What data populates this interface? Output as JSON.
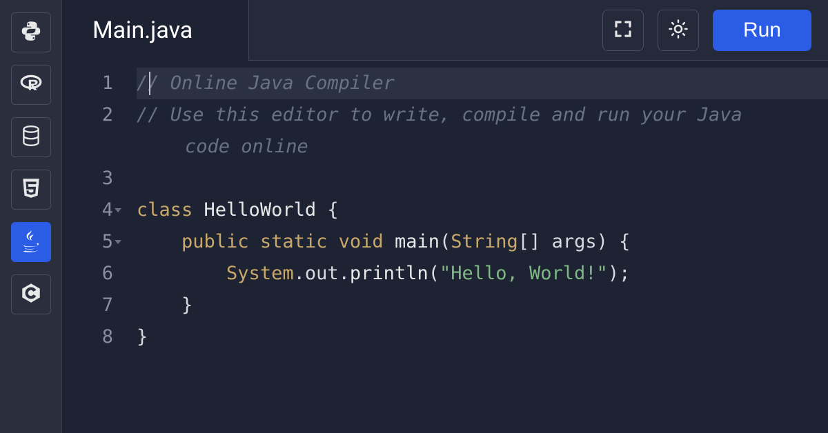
{
  "sidebar": {
    "items": [
      {
        "id": "python",
        "active": false
      },
      {
        "id": "r",
        "active": false
      },
      {
        "id": "sql",
        "active": false
      },
      {
        "id": "html",
        "active": false
      },
      {
        "id": "java",
        "active": true
      },
      {
        "id": "c",
        "active": false
      }
    ]
  },
  "header": {
    "tab_title": "Main.java",
    "run_label": "Run"
  },
  "editor": {
    "lines": [
      {
        "n": "1",
        "foldable": false,
        "highlighted": true
      },
      {
        "n": "2",
        "foldable": false,
        "highlighted": false
      },
      {
        "n": "3",
        "foldable": false,
        "highlighted": false
      },
      {
        "n": "4",
        "foldable": true,
        "highlighted": false
      },
      {
        "n": "5",
        "foldable": true,
        "highlighted": false
      },
      {
        "n": "6",
        "foldable": false,
        "highlighted": false
      },
      {
        "n": "7",
        "foldable": false,
        "highlighted": false
      },
      {
        "n": "8",
        "foldable": false,
        "highlighted": false
      }
    ],
    "tokens": {
      "l1_comment": "// Online Java Compiler",
      "l2_comment_a": "// Use this editor to write, compile and run your Java ",
      "l2_comment_b": "code online",
      "l4_kw_class": "class",
      "l4_name": " HelloWorld ",
      "l4_brace": "{",
      "l5_indent": "    ",
      "l5_kw_public": "public",
      "l5_sp1": " ",
      "l5_kw_static": "static",
      "l5_sp2": " ",
      "l5_kw_void": "void",
      "l5_sp3": " ",
      "l5_main": "main",
      "l5_paren_o": "(",
      "l5_type": "String",
      "l5_brackets": "[] ",
      "l5_args": "args",
      "l5_paren_c": ") ",
      "l5_brace": "{",
      "l6_indent": "        ",
      "l6_system": "System",
      "l6_dot1": ".",
      "l6_out": "out",
      "l6_dot2": ".",
      "l6_println": "println",
      "l6_paren_o": "(",
      "l6_string": "\"Hello, World!\"",
      "l6_paren_c": ")",
      "l6_semi": ";",
      "l7_indent": "    ",
      "l7_brace": "}",
      "l8_brace": "}"
    }
  }
}
